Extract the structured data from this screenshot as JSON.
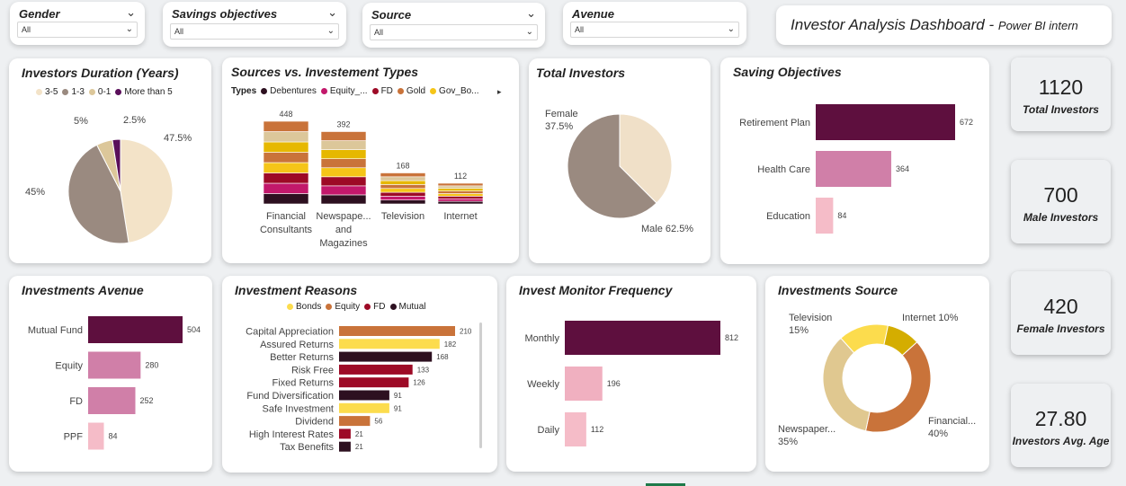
{
  "slicers": [
    {
      "label": "Gender",
      "value": "All"
    },
    {
      "label": "Savings objectives",
      "value": "All"
    },
    {
      "label": "Source",
      "value": "All"
    },
    {
      "label": "Avenue",
      "value": "All"
    }
  ],
  "header": {
    "title": "Investor Analysis Dashboard",
    "subtitle": "Power BI intern",
    "dash": "-"
  },
  "kpis": [
    {
      "value": "1120",
      "label": "Total Investors",
      "bg": "#5e0f3e",
      "color": "#ffffff"
    },
    {
      "value": "700",
      "label": "Male Investors",
      "bg": "#9d0a26",
      "color": "#ffffff"
    },
    {
      "value": "420",
      "label": "Female Investors",
      "bg": "#c9733a",
      "color": "#3a1a0a"
    },
    {
      "value": "27.80",
      "label": "Investors Avg. Age",
      "bg": "#fcdc4d",
      "color": "#222222"
    }
  ],
  "chart_data": [
    {
      "id": "duration",
      "type": "pie",
      "title": "Investors Duration (Years)",
      "legend": [
        "3-5",
        "1-3",
        "0-1",
        "More than 5"
      ],
      "values": [
        47.5,
        45,
        5,
        2.5
      ],
      "labels": [
        "47.5%",
        "45%",
        "5%",
        "2.5%"
      ],
      "colors": [
        "#f3e3c8",
        "#9a8a80",
        "#dcc79a",
        "#5a0f5a"
      ]
    },
    {
      "id": "sources",
      "type": "bar",
      "stacked": true,
      "title": "Sources vs. Investement Types",
      "legend_title": "Types",
      "legend": [
        "Debentures",
        "Equity_...",
        "FD",
        "Gold",
        "Gov_Bo..."
      ],
      "legend_colors": [
        "#2d1020",
        "#c2186b",
        "#9d0a26",
        "#c9733a",
        "#f5c518"
      ],
      "categories": [
        "Financial Consultants",
        "Newspape... and Magazines",
        "Television",
        "Internet"
      ],
      "category_lines": [
        [
          "Financial",
          "Consultants"
        ],
        [
          "Newspape...",
          "and",
          "Magazines"
        ],
        [
          "Television"
        ],
        [
          "Internet"
        ]
      ],
      "totals": [
        448,
        392,
        168,
        112
      ],
      "segment_colors": [
        "#2d1020",
        "#c2186b",
        "#9d0a26",
        "#f5c518",
        "#c9733a",
        "#e6b800",
        "#dcc79a",
        "#c9733a",
        "#e0c890"
      ]
    },
    {
      "id": "total_investors",
      "type": "pie",
      "title": "Total Investors",
      "categories": [
        "Female",
        "Male"
      ],
      "values": [
        37.5,
        62.5
      ],
      "labels": [
        "37.5%",
        "62.5%"
      ],
      "colors": [
        "#f0e0c8",
        "#9a8a80"
      ]
    },
    {
      "id": "saving_objectives",
      "type": "bar",
      "orientation": "horizontal",
      "title": "Saving Objectives",
      "categories": [
        "Retirement Plan",
        "Health Care",
        "Education"
      ],
      "values": [
        672,
        364,
        84
      ],
      "colors": [
        "#5e0f3e",
        "#d07fa8",
        "#f5bcc8"
      ]
    },
    {
      "id": "avenue",
      "type": "bar",
      "orientation": "horizontal",
      "title": "Investments Avenue",
      "categories": [
        "Mutual Fund",
        "Equity",
        "FD",
        "PPF"
      ],
      "values": [
        504,
        280,
        252,
        84
      ],
      "colors": [
        "#5e0f3e",
        "#d07fa8",
        "#d07fa8",
        "#f5bcc8"
      ]
    },
    {
      "id": "reasons",
      "type": "bar",
      "orientation": "horizontal",
      "title": "Investment Reasons",
      "legend": [
        "Bonds",
        "Equity",
        "FD",
        "Mutual"
      ],
      "legend_colors": [
        "#fcdc4d",
        "#c9733a",
        "#9d0a26",
        "#2d1020"
      ],
      "categories": [
        "Capital Appreciation",
        "Assured Returns",
        "Better Returns",
        "Risk Free",
        "Fixed Returns",
        "Fund Diversification",
        "Safe Investment",
        "Dividend",
        "High Interest Rates",
        "Tax Benefits"
      ],
      "values": [
        210,
        182,
        168,
        133,
        126,
        91,
        91,
        56,
        21,
        21
      ],
      "colors": [
        "#c9733a",
        "#fcdc4d",
        "#2d1020",
        "#9d0a26",
        "#9d0a26",
        "#2d1020",
        "#fcdc4d",
        "#c9733a",
        "#9d0a26",
        "#2d1020"
      ]
    },
    {
      "id": "monitor",
      "type": "bar",
      "orientation": "horizontal",
      "title": "Invest Monitor Frequency",
      "categories": [
        "Monthly",
        "Weekly",
        "Daily"
      ],
      "values": [
        812,
        196,
        112
      ],
      "colors": [
        "#5e0f3e",
        "#f0b0c0",
        "#f5bcc8"
      ]
    },
    {
      "id": "inv_source",
      "type": "pie",
      "donut": true,
      "title": "Investments Source",
      "categories": [
        "Television",
        "Internet",
        "Financial...",
        "Newspaper..."
      ],
      "values": [
        15,
        10,
        40,
        35
      ],
      "labels": [
        "15%",
        "10%",
        "40%",
        "35%"
      ],
      "colors": [
        "#fcdc4d",
        "#d4ad00",
        "#c9733a",
        "#e0c890"
      ]
    }
  ]
}
